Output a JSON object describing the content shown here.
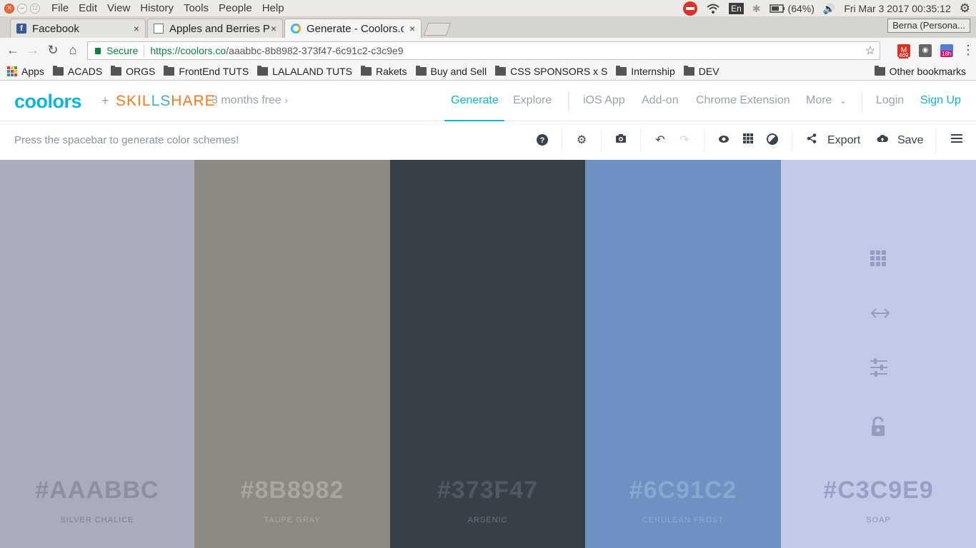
{
  "os": {
    "menus": [
      "File",
      "Edit",
      "View",
      "History",
      "Tools",
      "People",
      "Help"
    ],
    "lang": "En",
    "battery": "(64%)",
    "datetime": "Fri Mar  3 2017 00:35:12"
  },
  "tabs": [
    {
      "title": "Facebook",
      "icon": "facebook-icon"
    },
    {
      "title": "Apples and Berries P",
      "icon": "document-icon"
    },
    {
      "title": "Generate - Coolors.c",
      "icon": "coolors-icon"
    }
  ],
  "profile": "Berna (Persona...",
  "address": {
    "secure": "Secure",
    "url_main": "https://coolors.co",
    "url_rest": "/aaabbc-8b8982-373f47-6c91c2-c3c9e9"
  },
  "extensions": {
    "gmail_count": "469",
    "cal_badge": "18h"
  },
  "bookmarks": [
    "Apps",
    "ACADS",
    "ORGS",
    "FrontEnd TUTS",
    "LALALAND TUTS",
    "Rakets",
    "Buy and Sell",
    "CSS SPONSORS x S",
    "Internship",
    "DEV"
  ],
  "other_bookmarks": "Other bookmarks",
  "header": {
    "logo": "coolors",
    "plus": "+",
    "skill_letters": [
      "S",
      "K",
      "I",
      "L",
      "L",
      "S",
      "H",
      "A",
      "R",
      "E"
    ],
    "promo": "3 months free",
    "nav": [
      "Generate",
      "Explore",
      "iOS App",
      "Add-on",
      "Chrome Extension",
      "More"
    ],
    "login": "Login",
    "signup": "Sign Up"
  },
  "toolbar": {
    "hint": "Press the spacebar to generate color schemes!",
    "export": "Export",
    "save": "Save"
  },
  "palette": [
    {
      "hex": "#AAABBC",
      "name": "SILVER CHALICE",
      "color": "#aaabbc",
      "text": "#8e8f9e",
      "sub": "#7e7f8e"
    },
    {
      "hex": "#8B8982",
      "name": "TAUPE GRAY",
      "color": "#8b8982",
      "text": "#a8a6a0",
      "sub": "#aba9a3"
    },
    {
      "hex": "#373F47",
      "name": "ARSENIC",
      "color": "#373f47",
      "text": "#4f5863",
      "sub": "#6a737d"
    },
    {
      "hex": "#6C91C2",
      "name": "CERULEAN FROST",
      "color": "#6c91c2",
      "text": "#89a8d0",
      "sub": "#8eabd2"
    },
    {
      "hex": "#C3C9E9",
      "name": "SOAP",
      "color": "#c3c9e9",
      "text": "#999fc4",
      "sub": "#8c93b8"
    }
  ],
  "colors": {
    "accent": "#0ab5e0",
    "skill_orange": "#f47b20",
    "skill_teal": "#3fb0c7"
  }
}
